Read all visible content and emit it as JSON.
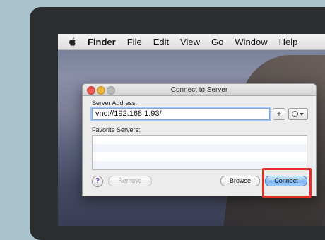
{
  "menubar": {
    "apple_icon": "apple-icon",
    "items": [
      "Finder",
      "File",
      "Edit",
      "View",
      "Go",
      "Window",
      "Help"
    ]
  },
  "dialog": {
    "title": "Connect to Server",
    "server_address_label": "Server Address:",
    "server_address_value": "vnc://192.168.1.93/",
    "add_button_label": "+",
    "recent_icon": "clock-icon",
    "favorite_servers_label": "Favorite Servers:",
    "help_label": "?",
    "remove_label": "Remove",
    "browse_label": "Browse",
    "connect_label": "Connect"
  },
  "annotation": {
    "color": "#e5312b"
  }
}
